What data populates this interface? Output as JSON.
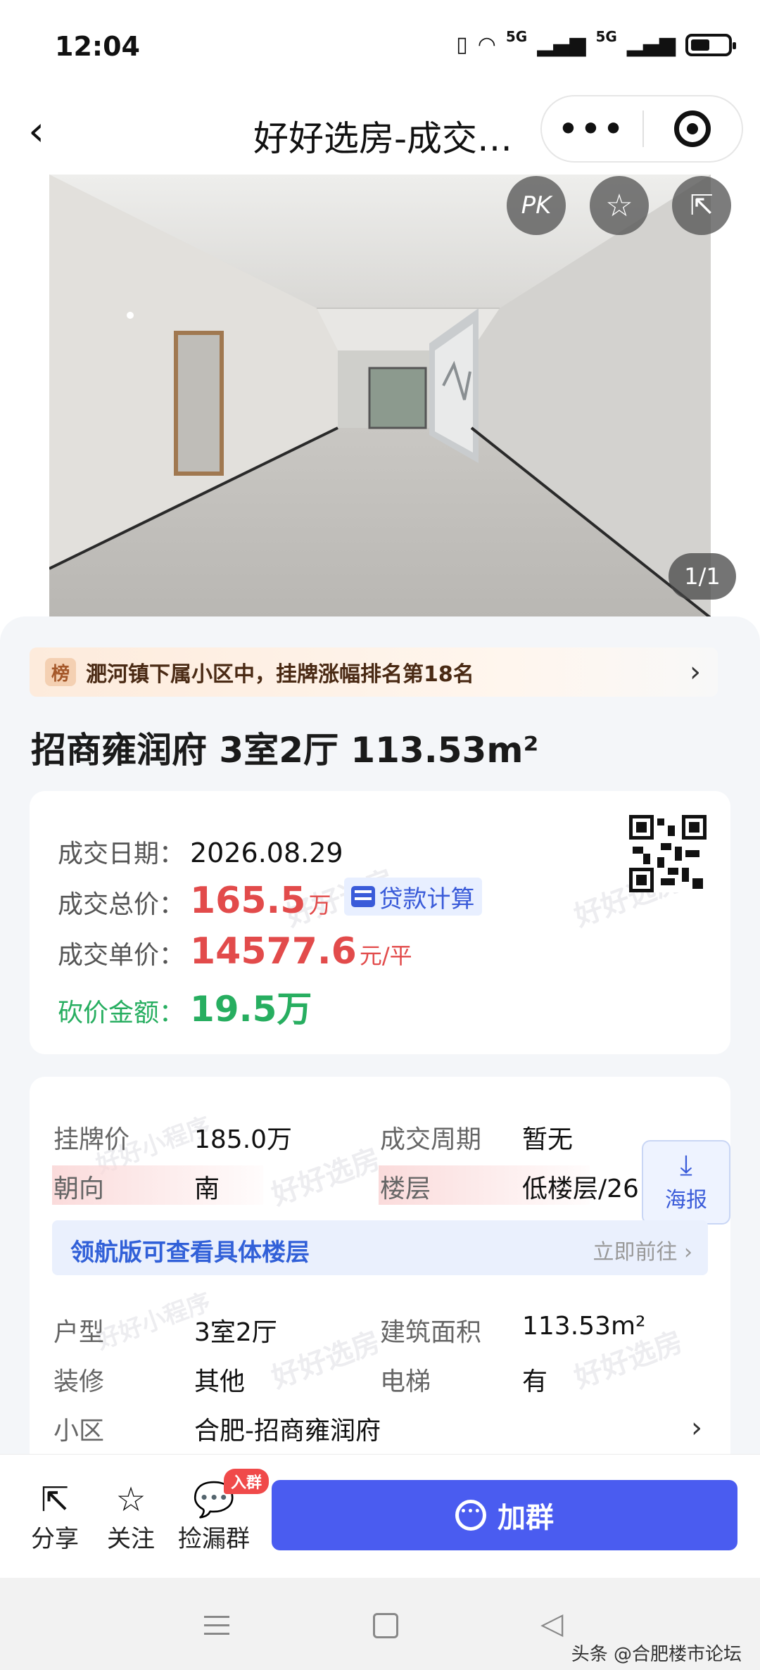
{
  "status_bar": {
    "time": "12:04",
    "sig1": "5G",
    "sig2": "5G"
  },
  "nav": {
    "title": "好好选房-成交…",
    "more_label": "•••"
  },
  "photo": {
    "pk_label": "PK",
    "counter": "1/1"
  },
  "rank": {
    "badge": "榜",
    "text": "淝河镇下属小区中，挂牌涨幅排名第18名"
  },
  "headline": "招商雍润府 3室2厅 113.53m²",
  "deal": {
    "date_label": "成交日期：",
    "date": "2026.08.29",
    "total_label": "成交总价：",
    "total": "165.5",
    "total_unit": "万",
    "loan_button": "贷款计算",
    "unit_label": "成交单价：",
    "unit_price": "14577.6",
    "unit_price_unit": "元/平",
    "cut_label": "砍价金额：",
    "cut": "19.5万"
  },
  "watermark": {
    "a": "好好选房",
    "b": "好好小程序"
  },
  "details": {
    "list_price_label": "挂牌价",
    "list_price": "185.0万",
    "cycle_label": "成交周期",
    "cycle": "暂无",
    "orient_label": "朝向",
    "orient": "南",
    "floor_label": "楼层",
    "floor": "低楼层/26",
    "poster_label": "海报",
    "upgrade_text": "领航版可查看具体楼层",
    "upgrade_go": "立即前往 ›",
    "layout_label": "户型",
    "layout": "3室2厅",
    "area_label": "建筑面积",
    "area": "113.53m²",
    "deco_label": "装修",
    "deco": "其他",
    "elevator_label": "电梯",
    "elevator": "有",
    "community_label": "小区",
    "community": "合肥-招商雍润府"
  },
  "bottom": {
    "share": "分享",
    "follow": "关注",
    "group": "捡漏群",
    "group_badge": "入群",
    "join": "加群"
  },
  "credit": "头条 @合肥楼市论坛",
  "colors": {
    "accent": "#4a5cf0",
    "price_red": "#e24b4b",
    "cut_green": "#27ae60"
  }
}
